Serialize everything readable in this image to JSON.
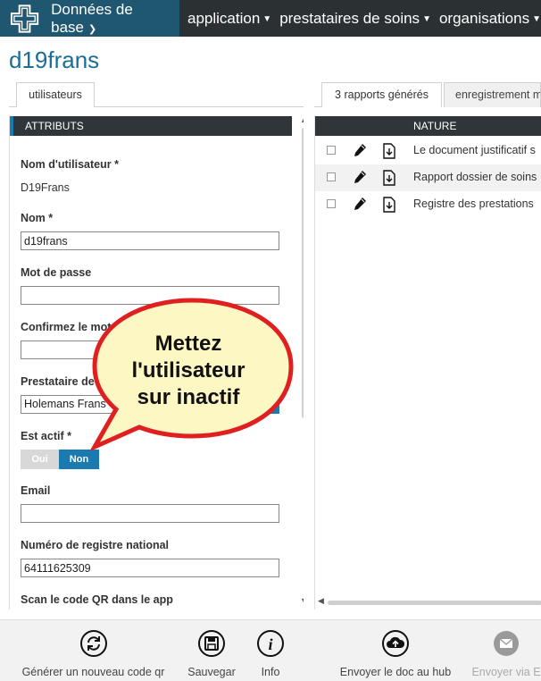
{
  "nav": {
    "brand": "Données de base",
    "items": [
      {
        "label": "application"
      },
      {
        "label": "prestataires de soins"
      },
      {
        "label": "organisations"
      }
    ]
  },
  "page_title": "d19frans",
  "left_tabs": [
    "utilisateurs"
  ],
  "right_tabs": [
    "3 rapports générés",
    "enregistrement m"
  ],
  "section_title": "ATTRIBUTS",
  "form": {
    "username_label": "Nom d'utilisateur *",
    "username_value": "D19Frans",
    "name_label": "Nom *",
    "name_value": "d19frans",
    "password_label": "Mot de passe",
    "password_value": "",
    "confirm_label": "Confirmez le mot",
    "confirm_value": "",
    "provider_label": "Prestataire de",
    "provider_value": "Holemans Frans",
    "active_label": "Est actif *",
    "toggle_yes": "Oui",
    "toggle_no": "Non",
    "active_selected": "Non",
    "email_label": "Email",
    "email_value": "",
    "national_label": "Numéro de registre national",
    "national_value": "64111625309",
    "qr_label": "Scan le code QR dans le app"
  },
  "reports": {
    "header": "NATURE",
    "rows": [
      {
        "nature": "Le document justificatif s"
      },
      {
        "nature": "Rapport dossier de soins"
      },
      {
        "nature": "Registre des prestations"
      }
    ]
  },
  "toolbar": {
    "generate_qr": "Générer un nouveau code qr",
    "save": "Sauvegar",
    "info": "Info",
    "send_hub": "Envoyer le doc au hub",
    "send_via": "Envoyer via E"
  },
  "callout": {
    "line1": "Mettez",
    "line2": "l'utilisateur",
    "line3": "sur inactif"
  },
  "colors": {
    "accent": "#1b7bb0",
    "nav_bg": "#2b3033",
    "callout_fill": "#fdf7c4",
    "callout_border": "#e02020"
  }
}
